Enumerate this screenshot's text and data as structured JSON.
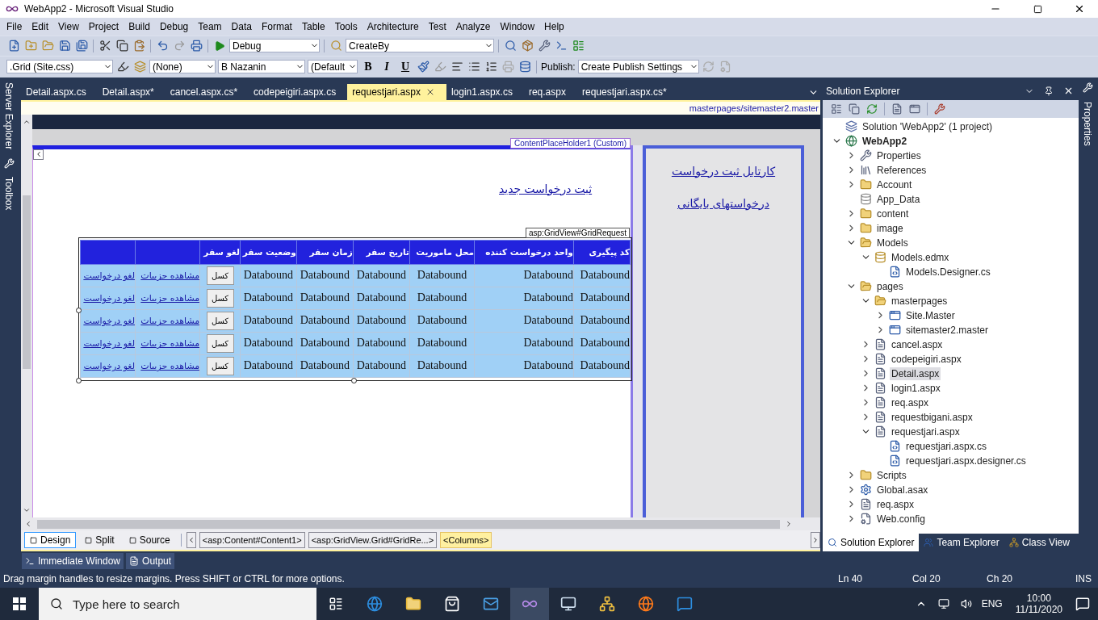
{
  "window": {
    "title": "WebApp2 - Microsoft Visual Studio"
  },
  "menu": [
    "File",
    "Edit",
    "View",
    "Project",
    "Build",
    "Debug",
    "Team",
    "Data",
    "Format",
    "Table",
    "Tools",
    "Architecture",
    "Test",
    "Analyze",
    "Window",
    "Help"
  ],
  "toolbar1": {
    "configuration": "Debug",
    "find": "CreateBy"
  },
  "toolbar2": {
    "style_target": ".Grid (Site.css)",
    "block_format": "(None)",
    "font": "B Nazanin",
    "size": "(Default",
    "bold": "B",
    "italic": "I",
    "underline": "U",
    "publish_label": "Publish:",
    "publish": "Create Publish Settings"
  },
  "side_left": [
    "Server Explorer",
    "Toolbox"
  ],
  "side_right": [
    "Properties"
  ],
  "doc_tabs": [
    {
      "label": "Detail.aspx.cs",
      "selected": false
    },
    {
      "label": "Detail.aspx*",
      "selected": false
    },
    {
      "label": "cancel.aspx.cs*",
      "selected": false
    },
    {
      "label": "codepeigiri.aspx.cs",
      "selected": false
    },
    {
      "label": "requestjari.aspx",
      "selected": true
    },
    {
      "label": "login1.aspx.cs",
      "selected": false
    },
    {
      "label": "req.aspx",
      "selected": false
    },
    {
      "label": "requestjari.aspx.cs*",
      "selected": false
    }
  ],
  "master_path": "masterpages/sitemaster2.master",
  "designer": {
    "placeholder_tag": "ContentPlaceHolder1 (Custom)",
    "new_request_link": "ثبت درخواست جدید",
    "side_links": [
      "کارتابل ثبت درخواست",
      "درخواستهای بایگانی"
    ],
    "grid_tag": "asp:GridView#GridRequest",
    "grid": {
      "columns": [
        {
          "kind": "blank"
        },
        {
          "kind": "blank"
        },
        {
          "kind": "label",
          "text": "لغو سفر"
        },
        {
          "kind": "label",
          "text": "وضعیت سفر"
        },
        {
          "kind": "label",
          "text": "زمان سفر"
        },
        {
          "kind": "label",
          "text": "تاریخ سفر"
        },
        {
          "kind": "label",
          "text": "محل ماموریت"
        },
        {
          "kind": "label",
          "text": "واحد درخواست کننده"
        },
        {
          "kind": "label",
          "text": "کد پیگیری"
        }
      ],
      "rows": [
        {
          "cells": [
            {
              "kind": "link",
              "text": "لغو درخواست"
            },
            {
              "kind": "link",
              "text": "مشاهده جزییات"
            },
            {
              "kind": "button",
              "text": "کسل"
            },
            {
              "kind": "text",
              "text": "Databound"
            },
            {
              "kind": "text",
              "text": "Databound"
            },
            {
              "kind": "text",
              "text": "Databound"
            },
            {
              "kind": "text",
              "text": "Databound"
            },
            {
              "kind": "text",
              "text": "Databound"
            },
            {
              "kind": "text",
              "text": "Databound"
            }
          ]
        },
        {
          "cells": [
            {
              "kind": "link",
              "text": "لغو درخواست"
            },
            {
              "kind": "link",
              "text": "مشاهده جزییات"
            },
            {
              "kind": "button",
              "text": "کسل"
            },
            {
              "kind": "text",
              "text": "Databound"
            },
            {
              "kind": "text",
              "text": "Databound"
            },
            {
              "kind": "text",
              "text": "Databound"
            },
            {
              "kind": "text",
              "text": "Databound"
            },
            {
              "kind": "text",
              "text": "Databound"
            },
            {
              "kind": "text",
              "text": "Databound"
            }
          ]
        },
        {
          "cells": [
            {
              "kind": "link",
              "text": "لغو درخواست"
            },
            {
              "kind": "link",
              "text": "مشاهده جزییات"
            },
            {
              "kind": "button",
              "text": "کسل"
            },
            {
              "kind": "text",
              "text": "Databound"
            },
            {
              "kind": "text",
              "text": "Databound"
            },
            {
              "kind": "text",
              "text": "Databound"
            },
            {
              "kind": "text",
              "text": "Databound"
            },
            {
              "kind": "text",
              "text": "Databound"
            },
            {
              "kind": "text",
              "text": "Databound"
            }
          ]
        },
        {
          "cells": [
            {
              "kind": "link",
              "text": "لغو درخواست"
            },
            {
              "kind": "link",
              "text": "مشاهده جزییات"
            },
            {
              "kind": "button",
              "text": "کسل"
            },
            {
              "kind": "text",
              "text": "Databound"
            },
            {
              "kind": "text",
              "text": "Databound"
            },
            {
              "kind": "text",
              "text": "Databound"
            },
            {
              "kind": "text",
              "text": "Databound"
            },
            {
              "kind": "text",
              "text": "Databound"
            },
            {
              "kind": "text",
              "text": "Databound"
            }
          ]
        },
        {
          "cells": [
            {
              "kind": "link",
              "text": "لغو درخواست"
            },
            {
              "kind": "link",
              "text": "مشاهده جزییات"
            },
            {
              "kind": "button",
              "text": "کسل"
            },
            {
              "kind": "text",
              "text": "Databound"
            },
            {
              "kind": "text",
              "text": "Databound"
            },
            {
              "kind": "text",
              "text": "Databound"
            },
            {
              "kind": "text",
              "text": "Databound"
            },
            {
              "kind": "text",
              "text": "Databound"
            },
            {
              "kind": "text",
              "text": "Databound"
            }
          ]
        }
      ]
    }
  },
  "view_tabs": [
    {
      "label": "Design",
      "selected": true
    },
    {
      "label": "Split",
      "selected": false
    },
    {
      "label": "Source",
      "selected": false
    }
  ],
  "breadcrumb": [
    {
      "label": "<asp:Content#Content1>",
      "selected": false
    },
    {
      "label": "<asp:GridView.Grid#GridRe...>",
      "selected": false
    },
    {
      "label": "<Columns>",
      "selected": true
    }
  ],
  "solution_explorer": {
    "title": "Solution Explorer",
    "tree": [
      {
        "label": "Solution 'WebApp2' (1 project)",
        "kind": "solution",
        "selected": false
      },
      {
        "label": "WebApp2",
        "kind": "project",
        "selected": false,
        "expanded": true,
        "children": [
          {
            "label": "Properties",
            "kind": "properties",
            "selected": false,
            "expanded": false
          },
          {
            "label": "References",
            "kind": "references",
            "selected": false,
            "expanded": false
          },
          {
            "label": "Account",
            "kind": "folder",
            "selected": false,
            "expanded": false
          },
          {
            "label": "App_Data",
            "kind": "datafolder",
            "selected": false
          },
          {
            "label": "content",
            "kind": "folder",
            "selected": false,
            "expanded": false
          },
          {
            "label": "image",
            "kind": "folder",
            "selected": false,
            "expanded": false
          },
          {
            "label": "Models",
            "kind": "folder",
            "selected": false,
            "expanded": true,
            "children": [
              {
                "label": "Models.edmx",
                "kind": "edmx",
                "selected": false,
                "expanded": true,
                "children": [
                  {
                    "label": "Models.Designer.cs",
                    "kind": "code",
                    "selected": false
                  }
                ]
              }
            ]
          },
          {
            "label": "pages",
            "kind": "folder",
            "selected": false,
            "expanded": true,
            "children": [
              {
                "label": "masterpages",
                "kind": "folder",
                "selected": false,
                "expanded": true,
                "children": [
                  {
                    "label": "Site.Master",
                    "kind": "master",
                    "selected": false,
                    "expanded": false
                  },
                  {
                    "label": "sitemaster2.master",
                    "kind": "master",
                    "selected": false,
                    "expanded": false
                  }
                ]
              },
              {
                "label": "cancel.aspx",
                "kind": "page",
                "selected": false,
                "expanded": false
              },
              {
                "label": "codepeigiri.aspx",
                "kind": "page",
                "selected": false,
                "expanded": false
              },
              {
                "label": "Detail.aspx",
                "kind": "page",
                "selected": true,
                "expanded": false
              },
              {
                "label": "login1.aspx",
                "kind": "page",
                "selected": false,
                "expanded": false
              },
              {
                "label": "req.aspx",
                "kind": "page",
                "selected": false,
                "expanded": false
              },
              {
                "label": "requestbigani.aspx",
                "kind": "page",
                "selected": false,
                "expanded": false
              },
              {
                "label": "requestjari.aspx",
                "kind": "page",
                "selected": false,
                "expanded": true,
                "children": [
                  {
                    "label": "requestjari.aspx.cs",
                    "kind": "code",
                    "selected": false
                  },
                  {
                    "label": "requestjari.aspx.designer.cs",
                    "kind": "code",
                    "selected": false
                  }
                ]
              }
            ]
          },
          {
            "label": "Scripts",
            "kind": "folder",
            "selected": false,
            "expanded": false
          },
          {
            "label": "Global.asax",
            "kind": "asax",
            "selected": false,
            "expanded": false
          },
          {
            "label": "req.aspx",
            "kind": "page",
            "selected": false,
            "expanded": false
          },
          {
            "label": "Web.config",
            "kind": "config",
            "selected": false,
            "expanded": false
          }
        ]
      }
    ],
    "tabs": [
      {
        "label": "Solution Explorer",
        "selected": true
      },
      {
        "label": "Team Explorer",
        "selected": false
      },
      {
        "label": "Class View",
        "selected": false
      }
    ]
  },
  "tool_windows": [
    "Immediate Window",
    "Output"
  ],
  "status_bar": {
    "message": "Drag margin handles to resize margins. Press SHIFT or CTRL for more options.",
    "line": "Ln 40",
    "column": "Col 20",
    "char": "Ch 20",
    "mode": "INS"
  },
  "taskbar": {
    "search_placeholder": "Type here to search",
    "language": "ENG",
    "time": "10:00",
    "date": "11/11/2020"
  }
}
